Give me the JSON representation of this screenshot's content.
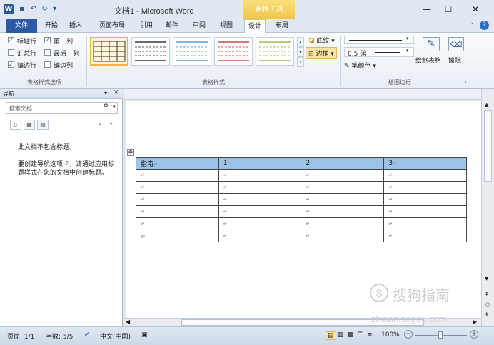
{
  "titlebar": {
    "app_icon": "W",
    "title": "文档1 - Microsoft Word",
    "context_tab": "表格工具",
    "minimize": "—",
    "maximize": "☐",
    "close": "✕"
  },
  "tabs": {
    "file": "文件",
    "items": [
      "开始",
      "插入",
      "页面布局",
      "引用",
      "邮件",
      "审阅",
      "视图",
      "设计",
      "布局"
    ],
    "active": "设计"
  },
  "ribbon": {
    "style_options": {
      "header_row": "标题行",
      "first_column": "第一列",
      "total_row": "汇总行",
      "last_column": "最后一列",
      "banded_rows": "镶边行",
      "banded_columns": "镶边列",
      "group_label": "表格样式选项",
      "checked": {
        "header_row": true,
        "first_column": true,
        "total_row": false,
        "last_column": false,
        "banded_rows": true,
        "banded_columns": false
      }
    },
    "table_styles": {
      "group_label": "表格样式",
      "shading": "底纹",
      "borders": "边框",
      "thumb_colors": [
        "#3a3a3a",
        "#3a3a3a",
        "#5b9bd5",
        "#c0504d",
        "#9bbb59"
      ]
    },
    "draw_borders": {
      "pen_weight": "0.5 磅",
      "pen_color": "笔颜色",
      "draw_table": "绘制表格",
      "eraser": "擦除",
      "group_label": "绘图边框"
    }
  },
  "nav": {
    "title": "导航",
    "search_placeholder": "搜索文档",
    "msg1": "此文档不包含标题。",
    "msg2": "要创建导航选项卡，请通过应用标题样式在您的文档中创建标题。"
  },
  "table": {
    "header": [
      "指南",
      "1",
      "2",
      "3"
    ],
    "empty_rows": 6
  },
  "status": {
    "page": "页面: 1/1",
    "words": "字数: 5/5",
    "language": "中文(中国)",
    "zoom": "100%"
  },
  "watermark": {
    "brand": "搜狗指南",
    "url": "zhinan.sogou.com"
  }
}
